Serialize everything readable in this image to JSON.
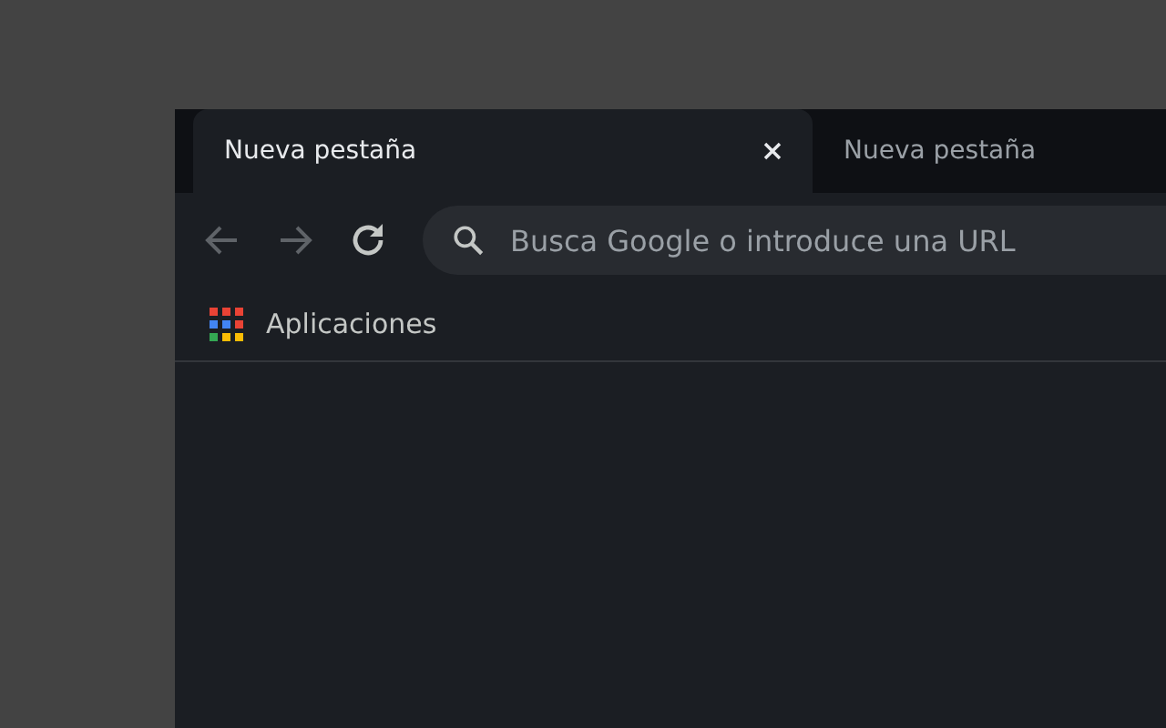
{
  "tabs": [
    {
      "label": "Nueva pestaña",
      "selected": true
    },
    {
      "label": "Nueva pestaña",
      "selected": false
    }
  ],
  "toolbar": {
    "back": {
      "disabled": true
    },
    "forward": {
      "disabled": true
    },
    "address": {
      "placeholder": "Busca Google o introduce una URL"
    }
  },
  "bookmarks": [
    {
      "label": "Aplicaciones",
      "kind": "apps"
    }
  ]
}
